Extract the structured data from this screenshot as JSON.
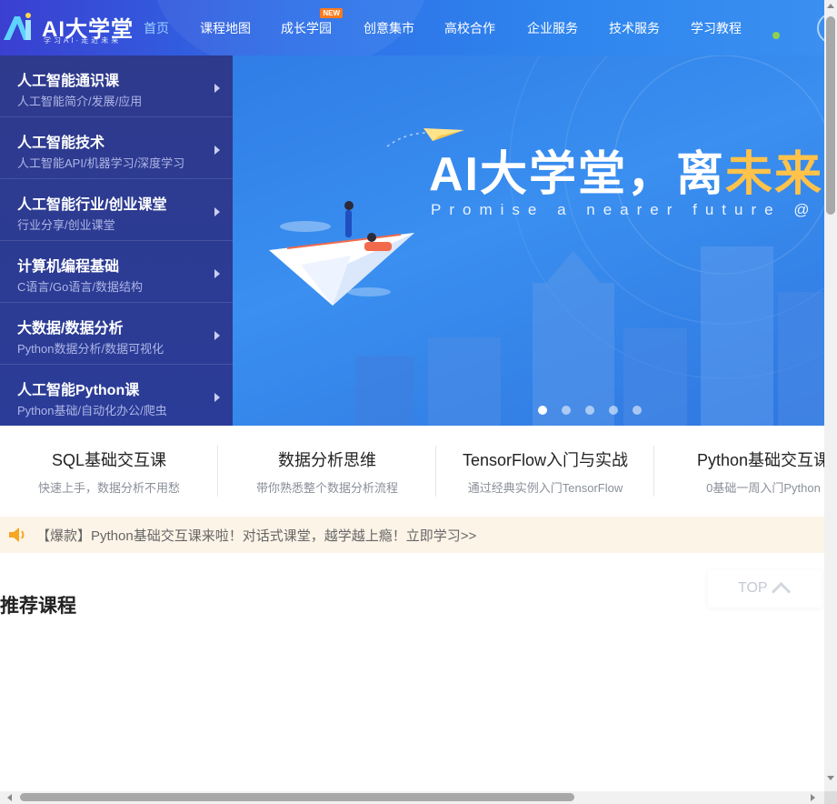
{
  "header": {
    "logo_text": "AI大学堂",
    "logo_slogan": "学习AI·走近未来",
    "nav": [
      {
        "label": "首页",
        "active": true
      },
      {
        "label": "课程地图"
      },
      {
        "label": "成长学园",
        "badge": "NEW"
      },
      {
        "label": "创意集市"
      },
      {
        "label": "高校合作"
      },
      {
        "label": "企业服务"
      },
      {
        "label": "技术服务"
      },
      {
        "label": "学习教程"
      }
    ]
  },
  "sidebar": {
    "items": [
      {
        "title": "人工智能通识课",
        "sub": "人工智能简介/发展/应用"
      },
      {
        "title": "人工智能技术",
        "sub": "人工智能API/机器学习/深度学习"
      },
      {
        "title": "人工智能行业/创业课堂",
        "sub": "行业分享/创业课堂"
      },
      {
        "title": "计算机编程基础",
        "sub": "C语言/Go语言/数据结构"
      },
      {
        "title": "大数据/数据分析",
        "sub": "Python数据分析/数据可视化"
      },
      {
        "title": "人工智能Python课",
        "sub": "Python基础/自动化办公/爬虫"
      }
    ]
  },
  "banner": {
    "title_main": "AI大学堂，离",
    "title_highlight": "未来",
    "subtitle": "Promise a nearer future @",
    "slide_count": 5,
    "active_slide": 0
  },
  "quick_courses": [
    {
      "title": "SQL基础交互课",
      "sub": "快速上手，数据分析不用愁"
    },
    {
      "title": "数据分析思维",
      "sub": "带你熟悉整个数据分析流程"
    },
    {
      "title": "TensorFlow入门与实战",
      "sub": "通过经典实例入门TensorFlow"
    },
    {
      "title": "Python基础交互课",
      "sub": "0基础一周入门Python"
    }
  ],
  "notice": {
    "text": "【爆款】Python基础交互课来啦！对话式课堂，越学越上瘾！立即学习>>"
  },
  "recommended": {
    "title": "推荐课程"
  },
  "back_to_top": {
    "label": "TOP"
  },
  "colors": {
    "header_start": "#3a3fd0",
    "header_end": "#3a8ff0",
    "sidebar_bg": "#2e3a8c",
    "accent_gold": "#ffc24a",
    "notice_bg": "#fdf4e8",
    "badge_orange": "#ff7a1a"
  }
}
